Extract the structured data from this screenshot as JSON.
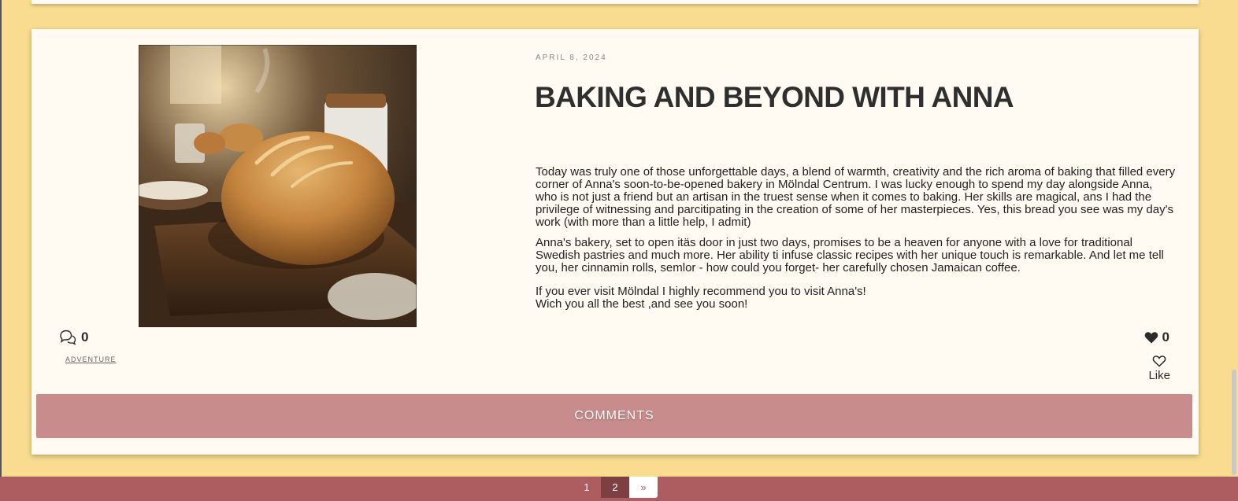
{
  "post": {
    "date": "APRIL 8, 2024",
    "title": "BAKING AND BEYOND WITH ANNA",
    "paragraphs": [
      "Today was truly one of those unforgettable  days, a blend of warmth, creativity and the rich aroma of baking that filled every corner of Anna's soon-to-be-opened bakery in Mölndal Centrum. I was lucky enough to spend my day alongside Anna, who is not just a friend but an artisan in the truest sense when it comes to baking. Her skills are magical, ans I had the privilege of witnessing and parcitipating in the creation of some of her masterpieces. Yes, this bread you see was my day's work (with more than a  little help, I admit)",
      "Anna's bakery, set to open itäs door in just two days, promises to be a heaven for anyone with a love for traditional Swedish pastries and much more.  Her ability ti infuse classic recipes with her unique touch is remarkable. And let me tell you, her cinnamin rolls, semlor - how could you forget- her carefully chosen Jamaican coffee.",
      "If you ever visit Mölndal I highly recommend you to visit Anna's!",
      "Wich you all the best ,and see you soon!"
    ],
    "comments_count": "0",
    "category": "ADVENTURE",
    "likes_count": "0",
    "like_label": "Like",
    "comments_button": "COMMENTS"
  },
  "pagination": {
    "pages": [
      "1",
      "2"
    ],
    "current": "2",
    "next": "»"
  },
  "colors": {
    "background": "#f9dc8f",
    "card": "#fffbf2",
    "comments_bar": "#c98c8c",
    "footer": "#ad5d5f",
    "current_page": "#7d3f42"
  },
  "icons": {
    "comments": "chat-bubbles-icon",
    "likes": "heart-filled-icon",
    "like_button": "heart-outline-icon"
  }
}
